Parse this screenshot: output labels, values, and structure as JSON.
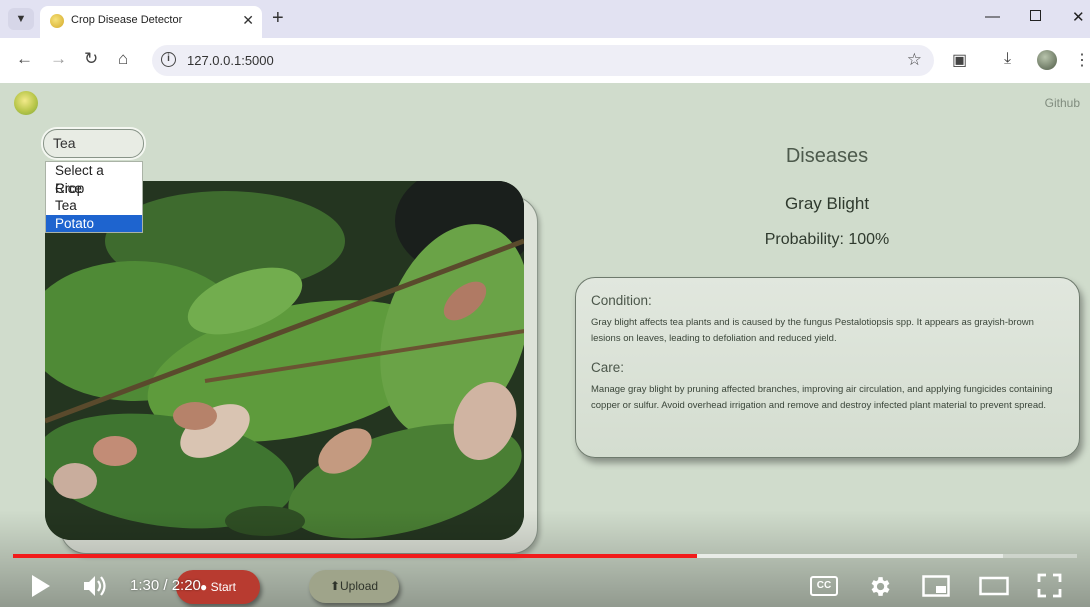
{
  "browser": {
    "tab_title": "Crop Disease Detector",
    "url": "127.0.0.1:5000"
  },
  "page": {
    "github_label": "Github",
    "crop_select": {
      "value": "Tea",
      "options": [
        "Select a Crop",
        "Rice",
        "Tea",
        "Potato"
      ],
      "highlighted": "Potato"
    },
    "results": {
      "title": "Diseases",
      "disease_name": "Gray Blight",
      "probability": "Probability: 100%"
    },
    "card": {
      "condition_heading": "Condition:",
      "condition_text": "Gray blight affects tea plants and is caused by the fungus Pestalotiopsis spp. It appears as grayish-brown lesions on leaves, leading to defoliation and reduced yield.",
      "care_heading": "Care:",
      "care_text": "Manage gray blight by pruning affected branches, improving air circulation, and applying fungicides containing copper or sulfur. Avoid overhead irrigation and remove and destroy infected plant material to prevent spread."
    },
    "start_label": "Start",
    "upload_label": "Upload"
  },
  "video": {
    "time": "1:30 / 2:20",
    "progress": 0.643,
    "buffered": 0.93,
    "accent_color": "#f21b1b"
  }
}
